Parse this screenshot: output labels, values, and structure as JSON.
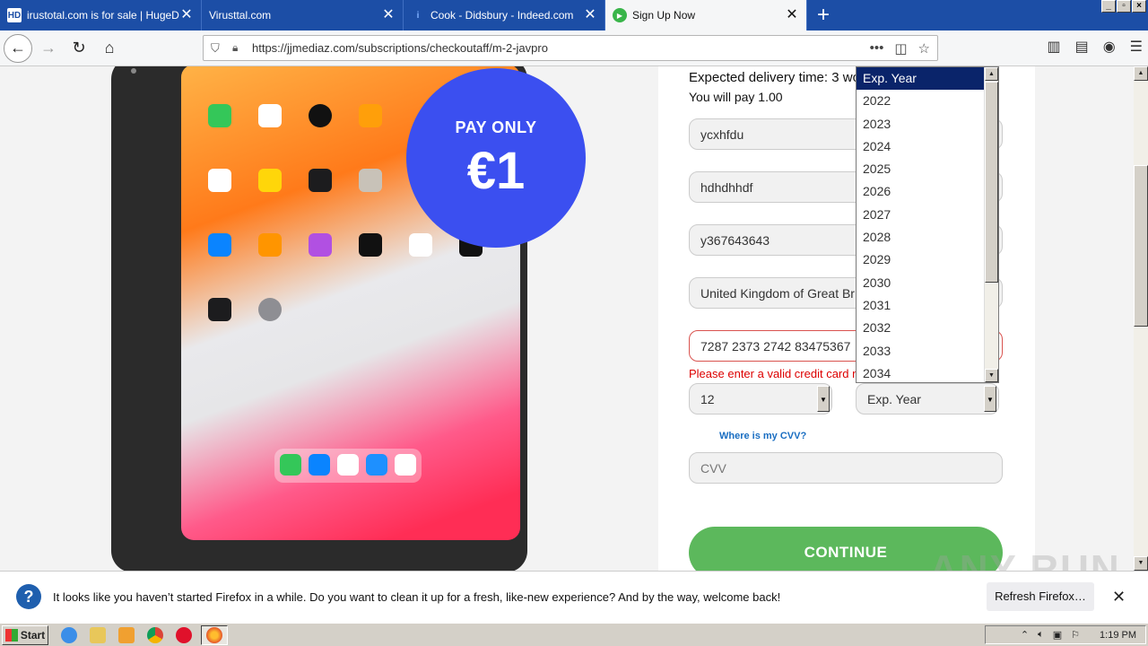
{
  "browser": {
    "tabs": [
      {
        "favicon": "HD",
        "title": "irustotal.com is for sale | HugeDomains"
      },
      {
        "favicon": "",
        "title": "Virusttal.com"
      },
      {
        "favicon": "i",
        "title": "Cook - Didsbury - Indeed.com"
      },
      {
        "favicon": "▶",
        "title": "Sign Up Now"
      }
    ],
    "new_tab_label": "+",
    "url": "https://jjmediaz.com/subscriptions/checkoutaff/m-2-javpro"
  },
  "promo": {
    "badge_line1": "PAY ONLY",
    "badge_line2": "€1"
  },
  "form": {
    "delivery_text": "Expected delivery time: 3 wo",
    "pay_text": "You will pay 1.00",
    "fields": [
      {
        "value": "ycxhfdu"
      },
      {
        "value": "hdhdhhdf"
      },
      {
        "value": "y367643643"
      },
      {
        "value": "United Kingdom of Great Br"
      }
    ],
    "card_number": "7287 2373 2742 83475367",
    "card_error": "Please enter a valid credit card n",
    "exp_month": "12",
    "exp_year": "Exp. Year",
    "cvv_link": "Where is my CVV?",
    "cvv_placeholder": "CVV",
    "continue_label": "CONTINUE"
  },
  "year_dropdown": {
    "options": [
      "Exp. Year",
      "2022",
      "2023",
      "2024",
      "2025",
      "2026",
      "2027",
      "2028",
      "2029",
      "2030",
      "2031",
      "2032",
      "2033",
      "2034"
    ],
    "selected_index": 0
  },
  "notification": {
    "message": "It looks like you haven’t started Firefox in a while. Do you want to clean it up for a fresh, like-new experience? And by the way, welcome back!",
    "refresh_label": "Refresh Firefox…",
    "close_label": "✕"
  },
  "watermark": "ANY RUN",
  "taskbar": {
    "start_label": "Start",
    "clock": "1:19 PM"
  },
  "colors": {
    "tab_strip": "#1c4ea6",
    "badge": "#3b4ff0",
    "continue": "#5cb85c",
    "error": "#d00000"
  }
}
